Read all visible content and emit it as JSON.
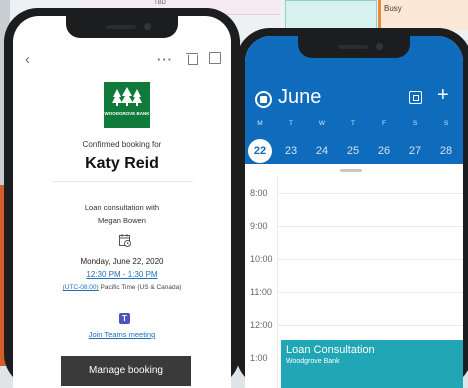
{
  "background": {
    "top_tag": "TBD",
    "busy_label": "Busy"
  },
  "email": {
    "bank_logo": "WOODGROVE BANK",
    "confirmed_label": "Confirmed booking for",
    "customer_name": "Katy Reid",
    "service_line1": "Loan consultation with",
    "service_line2": "Megan Bowen",
    "date": "Monday, June 22, 2020",
    "time": "12:30 PM - 1:30 PM",
    "timezone_code": "(UTC-08:00)",
    "timezone_name": "Pacific Time (US & Canada)",
    "join_link": "Join Teams meeting",
    "manage_button": "Manage booking"
  },
  "calendar": {
    "month": "June",
    "weekdays": [
      "M",
      "T",
      "W",
      "T",
      "F",
      "S",
      "S"
    ],
    "dates": [
      "22",
      "23",
      "24",
      "25",
      "26",
      "27",
      "28"
    ],
    "selected_date": "22",
    "hours": [
      "8:00",
      "9:00",
      "10:00",
      "11:00",
      "12:00",
      "1:00"
    ],
    "event": {
      "title": "Loan Consultation",
      "subtitle": "Woodgrove Bank"
    },
    "colors": {
      "header": "#0f6cbd",
      "event": "#21a6b5"
    }
  }
}
